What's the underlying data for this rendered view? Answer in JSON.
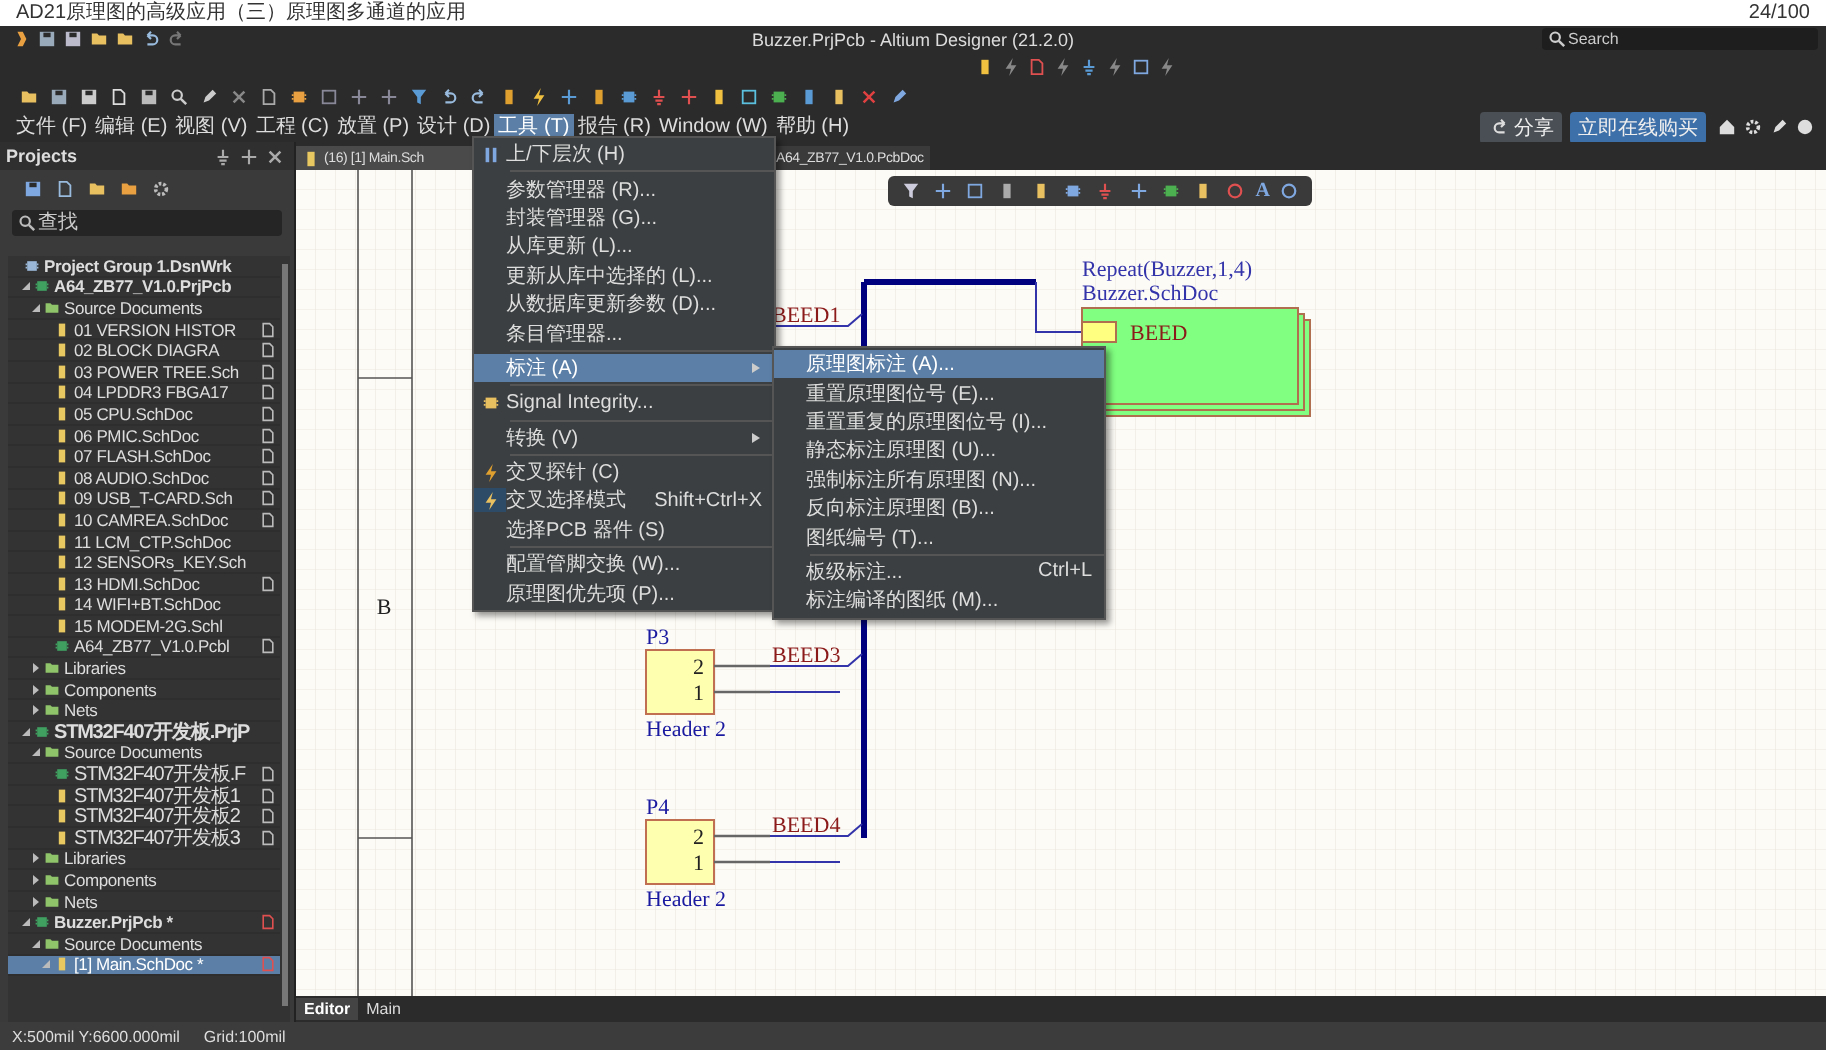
{
  "page_header": {
    "title": "AD21原理图的高级应用（三）原理图多通道的应用",
    "page_count": "24/100"
  },
  "window": {
    "title": "Buzzer.PrjPcb - Altium Designer (21.2.0)",
    "search": {
      "placeholder": "Search"
    }
  },
  "menu_bar": [
    {
      "label": "文件 (F)",
      "selected": false
    },
    {
      "label": "编辑 (E)",
      "selected": false
    },
    {
      "label": "视图 (V)",
      "selected": false
    },
    {
      "label": "工程 (C)",
      "selected": false
    },
    {
      "label": "放置 (P)",
      "selected": false
    },
    {
      "label": "设计 (D)",
      "selected": false
    },
    {
      "label": "工具 (T)",
      "selected": true
    },
    {
      "label": "报告 (R)",
      "selected": false
    },
    {
      "label": "Window (W)",
      "selected": false
    },
    {
      "label": "帮助 (H)",
      "selected": false
    }
  ],
  "header_buttons": [
    {
      "kind": "share",
      "label": "分享"
    },
    {
      "kind": "buy",
      "label": "立即在线购买"
    }
  ],
  "projects_panel": {
    "title": "Projects",
    "search": {
      "placeholder": "查找"
    },
    "tree": [
      {
        "kind": "group",
        "label": "Project Group 1.DsnWrk",
        "selected": false,
        "children": [
          {
            "kind": "project",
            "label": "A64_ZB77_V1.0.PrjPcb",
            "selected": false,
            "expanded": true,
            "children": [
              {
                "kind": "folder",
                "label": "Source Documents",
                "selected": false,
                "expanded": true,
                "children": [
                  {
                    "kind": "schdoc",
                    "label": "01 VERSION HISTOR",
                    "selected": false,
                    "open": true
                  },
                  {
                    "kind": "schdoc",
                    "label": "02 BLOCK DIAGRA",
                    "selected": false,
                    "open": true
                  },
                  {
                    "kind": "schdoc",
                    "label": "03 POWER TREE.Sch",
                    "selected": false,
                    "open": true
                  },
                  {
                    "kind": "schdoc",
                    "label": "04 LPDDR3 FBGA17",
                    "selected": false,
                    "open": true
                  },
                  {
                    "kind": "schdoc",
                    "label": "05 CPU.SchDoc",
                    "selected": false,
                    "open": true
                  },
                  {
                    "kind": "schdoc",
                    "label": "06 PMIC.SchDoc",
                    "selected": false,
                    "open": true
                  },
                  {
                    "kind": "schdoc",
                    "label": "07 FLASH.SchDoc",
                    "selected": false,
                    "open": true
                  },
                  {
                    "kind": "schdoc",
                    "label": "08 AUDIO.SchDoc",
                    "selected": false,
                    "open": true
                  },
                  {
                    "kind": "schdoc",
                    "label": "09 USB_T-CARD.Sch",
                    "selected": false,
                    "open": true
                  },
                  {
                    "kind": "schdoc",
                    "label": "10 CAMREA.SchDoc",
                    "selected": false,
                    "open": true
                  },
                  {
                    "kind": "schdoc",
                    "label": "11 LCM_CTP.SchDoc",
                    "selected": false,
                    "open": false
                  },
                  {
                    "kind": "schdoc",
                    "label": "12 SENSORs_KEY.Sch",
                    "selected": false,
                    "open": false
                  },
                  {
                    "kind": "schdoc",
                    "label": "13 HDMI.SchDoc",
                    "selected": false,
                    "open": true
                  },
                  {
                    "kind": "schdoc",
                    "label": "14 WIFI+BT.SchDoc",
                    "selected": false,
                    "open": false
                  },
                  {
                    "kind": "schdoc",
                    "label": "15 MODEM-2G.Schl",
                    "selected": false,
                    "open": false
                  },
                  {
                    "kind": "pcbdoc",
                    "label": "A64_ZB77_V1.0.Pcbl",
                    "selected": false,
                    "open": true
                  }
                ]
              },
              {
                "kind": "folder",
                "label": "Libraries",
                "selected": false,
                "expanded": false
              },
              {
                "kind": "folder",
                "label": "Components",
                "selected": false,
                "expanded": false
              },
              {
                "kind": "folder",
                "label": "Nets",
                "selected": false,
                "expanded": false
              }
            ]
          },
          {
            "kind": "project",
            "label": "STM32F407开发板.PrjP",
            "selected": false,
            "expanded": true,
            "children": [
              {
                "kind": "folder",
                "label": "Source Documents",
                "selected": false,
                "expanded": true,
                "children": [
                  {
                    "kind": "pcbdoc",
                    "label": "STM32F407开发板.F",
                    "selected": false,
                    "open": true
                  },
                  {
                    "kind": "schdoc",
                    "label": "STM32F407开发板1",
                    "selected": false,
                    "open": true
                  },
                  {
                    "kind": "schdoc",
                    "label": "STM32F407开发板2",
                    "selected": false,
                    "open": true
                  },
                  {
                    "kind": "schdoc",
                    "label": "STM32F407开发板3",
                    "selected": false,
                    "open": true
                  }
                ]
              },
              {
                "kind": "folder",
                "label": "Libraries",
                "selected": false,
                "expanded": false
              },
              {
                "kind": "folder",
                "label": "Components",
                "selected": false,
                "expanded": false
              },
              {
                "kind": "folder",
                "label": "Nets",
                "selected": false,
                "expanded": false
              }
            ]
          },
          {
            "kind": "project",
            "label": "Buzzer.PrjPcb *",
            "selected": false,
            "expanded": true,
            "open": true,
            "modified": true,
            "children": [
              {
                "kind": "folder",
                "label": "Source Documents",
                "selected": false,
                "expanded": true,
                "children": [
                  {
                    "kind": "schdoc",
                    "label": "[1] Main.SchDoc *",
                    "selected": true,
                    "expanded": true,
                    "open": true,
                    "modified": true
                  }
                ]
              }
            ]
          }
        ]
      }
    ]
  },
  "document_tabs": [
    {
      "label": "(16) [1] Main.Sch",
      "selected": true
    },
    {
      "label": "A64_ZB77_V1.0.PcbDoc",
      "selected": false
    }
  ],
  "tools_menu": [
    {
      "kind": "command",
      "label": "上/下层次 (H)",
      "selected": false,
      "checked": false
    },
    {
      "kind": "separator"
    },
    {
      "kind": "command",
      "label": "参数管理器 (R)...",
      "selected": false,
      "checked": false
    },
    {
      "kind": "command",
      "label": "封装管理器 (G)...",
      "selected": false,
      "checked": false
    },
    {
      "kind": "command",
      "label": "从库更新 (L)...",
      "selected": false,
      "checked": false
    },
    {
      "kind": "command",
      "label": "更新从库中选择的 (L)...",
      "selected": false,
      "checked": false
    },
    {
      "kind": "command",
      "label": "从数据库更新参数 (D)...",
      "selected": false,
      "checked": false
    },
    {
      "kind": "command",
      "label": "条目管理器...",
      "selected": false,
      "checked": false
    },
    {
      "kind": "separator"
    },
    {
      "kind": "submenu",
      "label": "标注 (A)",
      "selected": true,
      "checked": false
    },
    {
      "kind": "separator"
    },
    {
      "kind": "command",
      "label": "Signal Integrity...",
      "selected": false,
      "checked": false
    },
    {
      "kind": "separator"
    },
    {
      "kind": "submenu",
      "label": "转换 (V)",
      "selected": false,
      "checked": false
    },
    {
      "kind": "separator"
    },
    {
      "kind": "command",
      "label": "交叉探针 (C)",
      "selected": false,
      "checked": false
    },
    {
      "kind": "command",
      "label": "交叉选择模式",
      "shortcut": "Shift+Ctrl+X",
      "selected": false,
      "checked": true
    },
    {
      "kind": "command",
      "label": "选择PCB 器件 (S)",
      "selected": false,
      "checked": false
    },
    {
      "kind": "separator"
    },
    {
      "kind": "command",
      "label": "配置管脚交换 (W)...",
      "selected": false,
      "checked": false
    },
    {
      "kind": "command",
      "label": "原理图优先项 (P)...",
      "selected": false,
      "checked": false
    }
  ],
  "annotate_submenu": [
    {
      "kind": "command",
      "label": "原理图标注 (A)...",
      "selected": true
    },
    {
      "kind": "command",
      "label": "重置原理图位号 (E)...",
      "selected": false
    },
    {
      "kind": "command",
      "label": "重置重复的原理图位号 (I)...",
      "selected": false
    },
    {
      "kind": "command",
      "label": "静态标注原理图 (U)...",
      "selected": false
    },
    {
      "kind": "command",
      "label": "强制标注所有原理图 (N)...",
      "selected": false
    },
    {
      "kind": "command",
      "label": "反向标注原理图 (B)...",
      "selected": false
    },
    {
      "kind": "command",
      "label": "图纸编号 (T)...",
      "selected": false
    },
    {
      "kind": "separator"
    },
    {
      "kind": "command",
      "label": "板级标注...",
      "shortcut": "Ctrl+L",
      "selected": false
    },
    {
      "kind": "command",
      "label": "标注编译的图纸 (M)...",
      "selected": false
    }
  ],
  "schematic": {
    "zone_label": "B",
    "text_tool_glyph": "A",
    "sheet_symbol": {
      "repeat": "Repeat(Buzzer,1,4)",
      "file": "Buzzer.SchDoc",
      "port": "BEED"
    },
    "connectors": [
      {
        "net": "BEED1"
      },
      {
        "designator": "P3",
        "pins": [
          "2",
          "1"
        ],
        "comment": "Header 2",
        "net": "BEED3"
      },
      {
        "designator": "P4",
        "pins": [
          "2",
          "1"
        ],
        "comment": "Header 2",
        "net": "BEED4"
      }
    ]
  },
  "editor_tabs": [
    {
      "label": "Editor",
      "selected": true
    },
    {
      "label": "Main",
      "selected": false
    }
  ],
  "status_bar": {
    "position": "X:500mil Y:6600.000mil",
    "grid": "Grid:100mil"
  }
}
